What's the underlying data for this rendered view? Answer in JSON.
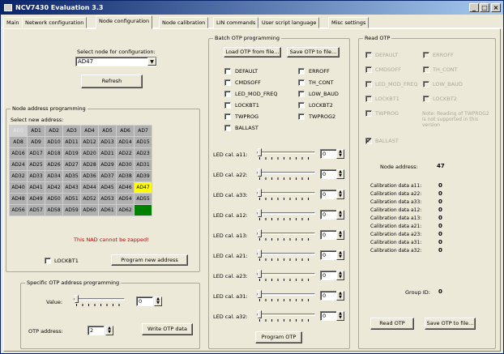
{
  "window": {
    "title": "NCV7430 Evaluation 3.3",
    "min": "_",
    "max": "□",
    "close": "×"
  },
  "tabs": [
    "Main",
    "Network configuration",
    "Node configuration",
    "Node calibration",
    "LIN commands",
    "User script language",
    "Misc settings"
  ],
  "node_select": {
    "label": "Select node for configuration:",
    "value": "AD47",
    "refresh": "Refresh"
  },
  "nap": {
    "title": "Node address programming",
    "select_label": "Select new address:",
    "grid": [
      [
        "AD0",
        "AD1",
        "AD2",
        "AD3",
        "AD4",
        "AD5",
        "AD6",
        "AD7"
      ],
      [
        "AD8",
        "AD9",
        "AD10",
        "AD11",
        "AD12",
        "AD13",
        "AD14",
        "AD15"
      ],
      [
        "AD16",
        "AD17",
        "AD18",
        "AD19",
        "AD20",
        "AD21",
        "AD22",
        "AD23"
      ],
      [
        "AD24",
        "AD25",
        "AD26",
        "AD27",
        "AD28",
        "AD29",
        "AD30",
        "AD31"
      ],
      [
        "AD32",
        "AD33",
        "AD34",
        "AD35",
        "AD36",
        "AD37",
        "AD38",
        "AD39"
      ],
      [
        "AD40",
        "AD41",
        "AD42",
        "AD43",
        "AD44",
        "AD45",
        "AD46",
        "AD47"
      ],
      [
        "AD48",
        "AD49",
        "AD50",
        "AD51",
        "AD52",
        "AD53",
        "AD54",
        "AD55"
      ],
      [
        "AD56",
        "AD57",
        "AD58",
        "AD59",
        "AD60",
        "AD61",
        "AD62",
        "AD63"
      ]
    ],
    "warning": "This NAD cannot be zapped!",
    "lockbt1": "LOCKBT1",
    "program": "Program new address",
    "colors": {
      "selected": "#ffff00",
      "reserved": "#008000",
      "warning": "#cc0000"
    }
  },
  "specific": {
    "title": "Specific OTP address programming",
    "value_label": "Value:",
    "value": "0",
    "addr_label": "OTP address:",
    "addr": "2",
    "write": "Write OTP data"
  },
  "batch": {
    "title": "Batch OTP programming",
    "load": "Load OTP from file...",
    "save": "Save OTP to file...",
    "left": [
      "DEFAULT",
      "CMDSOFF",
      "LED_MOD_FREQ",
      "LOCKBT1",
      "TWPROG",
      "BALLAST"
    ],
    "right": [
      "ERROFF",
      "TH_CONT",
      "LOW_BAUD",
      "LOCKBT2",
      "TWPROG2"
    ],
    "led": [
      "LED cal. a11:",
      "LED cal. a22:",
      "LED cal. a33:",
      "LED cal. a12:",
      "LED cal. a13:",
      "LED cal. a21:",
      "LED cal. a23:",
      "LED cal. a31:",
      "LED cal. a32:"
    ],
    "led_values": [
      "0",
      "0",
      "0",
      "0",
      "0",
      "0",
      "0",
      "0",
      "0"
    ],
    "program": "Program OTP"
  },
  "read": {
    "title": "Read OTP",
    "left": [
      "DEFAULT",
      "CMDSOFF",
      "LED_MOD_FREQ",
      "LOCKBT1",
      "TWPROG",
      "BALLAST"
    ],
    "right": [
      "ERROFF",
      "TH_CONT",
      "LOW_BAUD",
      "LOCKBT2"
    ],
    "note": "Note: Reading of TWPROG2 is not supported in this version",
    "node_address_label": "Node address:",
    "node_address": "47",
    "calib": [
      "Calibration data a11:",
      "Calibration data a22:",
      "Calibration data a33:",
      "Calibration data a12:",
      "Calibration data a13:",
      "Calibration data a21:",
      "Calibration data a23:",
      "Calibration data a31:",
      "Calibration data a32:"
    ],
    "calib_values": [
      "0",
      "0",
      "0",
      "0",
      "0",
      "0",
      "0",
      "0",
      "0"
    ],
    "group_label": "Group ID:",
    "group": "0",
    "read_btn": "Read OTP",
    "save_btn": "Save OTP to file..."
  }
}
